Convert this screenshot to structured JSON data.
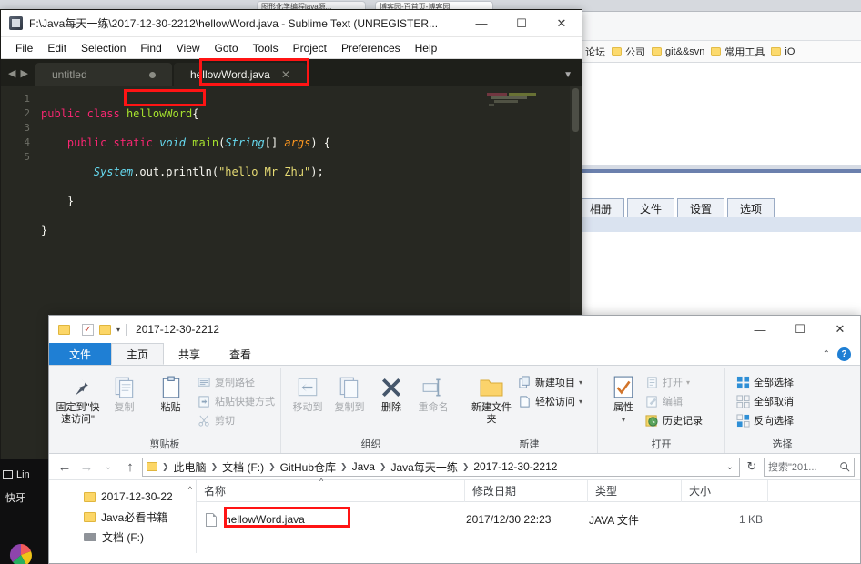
{
  "browser": {
    "tabs": [
      {
        "label": "图形化学编程java源...",
        "active": false
      },
      {
        "label": "博客园-百首页-博客园",
        "active": true
      }
    ],
    "bookmarks": [
      {
        "label": "论坛",
        "icon": "folder-icon"
      },
      {
        "label": "公司",
        "icon": "folder-icon"
      },
      {
        "label": "git&&svn",
        "icon": "folder-icon"
      },
      {
        "label": "常用工具",
        "icon": "folder-icon"
      },
      {
        "label": "iO",
        "icon": "folder-icon"
      }
    ],
    "page_tabs": [
      {
        "label": "相册"
      },
      {
        "label": "文件"
      },
      {
        "label": "设置"
      },
      {
        "label": "选项"
      }
    ]
  },
  "sublime": {
    "title": "F:\\Java每天一练\\2017-12-30-2212\\hellowWord.java - Sublime Text (UNREGISTER...",
    "window_buttons": {
      "minimize": "—",
      "maximize": "☐",
      "close": "✕"
    },
    "menu": [
      "File",
      "Edit",
      "Selection",
      "Find",
      "View",
      "Goto",
      "Tools",
      "Project",
      "Preferences",
      "Help"
    ],
    "tabs": [
      {
        "label": "untitled",
        "active": false,
        "modified": true
      },
      {
        "label": "hellowWord.java",
        "active": true,
        "modified": false
      }
    ],
    "gutter": [
      "1",
      "2",
      "3",
      "4",
      "5"
    ],
    "code_lines": [
      "public class hellowWord{",
      "    public static void main(String[] args) {",
      "        System.out.println(\"hello Mr Zhu\");",
      "    }",
      "}"
    ],
    "highlighted_token": "hellowWord{"
  },
  "explorer": {
    "title": "2017-12-30-2212",
    "window_buttons": {
      "minimize": "—",
      "maximize": "☐",
      "close": "✕"
    },
    "quick_access_caret": "▾",
    "ribbon_tabs": [
      {
        "label": "文件",
        "kind": "file"
      },
      {
        "label": "主页",
        "kind": "active"
      },
      {
        "label": "共享",
        "kind": "normal"
      },
      {
        "label": "查看",
        "kind": "normal"
      }
    ],
    "ribbon_collapse": "⌃",
    "ribbon_help": "?",
    "groups": [
      {
        "name": "剪贴板",
        "big": [
          {
            "label": "固定到\"快速访问\"",
            "icon": "pin-icon",
            "dim": false
          },
          {
            "label": "复制",
            "icon": "copy-icon",
            "dim": true
          },
          {
            "label": "粘贴",
            "icon": "paste-icon",
            "dim": false
          }
        ],
        "small": [
          {
            "label": "复制路径",
            "icon": "copy-path-icon",
            "dim": true
          },
          {
            "label": "粘贴快捷方式",
            "icon": "paste-shortcut-icon",
            "dim": true
          },
          {
            "label": "剪切",
            "icon": "scissors-icon",
            "dim": true
          }
        ]
      },
      {
        "name": "组织",
        "big": [
          {
            "label": "移动到",
            "icon": "move-to-icon",
            "dim": true
          },
          {
            "label": "复制到",
            "icon": "copy-to-icon",
            "dim": true
          },
          {
            "label": "删除",
            "icon": "delete-x-icon",
            "dim": false
          },
          {
            "label": "重命名",
            "icon": "rename-icon",
            "dim": true
          }
        ]
      },
      {
        "name": "新建",
        "big": [
          {
            "label": "新建文件夹",
            "icon": "new-folder-icon",
            "dim": false
          }
        ],
        "small": [
          {
            "label": "新建项目",
            "icon": "new-item-icon",
            "dim": false,
            "caret": "▾"
          },
          {
            "label": "轻松访问",
            "icon": "easy-access-icon",
            "dim": false,
            "caret": "▾"
          }
        ]
      },
      {
        "name": "打开",
        "big": [
          {
            "label": "属性",
            "icon": "properties-icon",
            "dim": false,
            "caret": "▾"
          }
        ],
        "small": [
          {
            "label": "打开",
            "icon": "open-icon",
            "dim": true,
            "caret": "▾"
          },
          {
            "label": "编辑",
            "icon": "edit-icon",
            "dim": true
          },
          {
            "label": "历史记录",
            "icon": "history-icon",
            "dim": false
          }
        ]
      },
      {
        "name": "选择",
        "small": [
          {
            "label": "全部选择",
            "icon": "select-all-icon",
            "dim": false
          },
          {
            "label": "全部取消",
            "icon": "select-none-icon",
            "dim": false
          },
          {
            "label": "反向选择",
            "icon": "invert-selection-icon",
            "dim": false
          }
        ]
      }
    ],
    "nav": {
      "back": "←",
      "forward": "→",
      "recent": "⌄",
      "up": "↑",
      "breadcrumbs": [
        "此电脑",
        "文档 (F:)",
        "GitHub仓库",
        "Java",
        "Java每天一练",
        "2017-12-30-2212"
      ],
      "dropdown": "⌄",
      "refresh": "↻",
      "search_placeholder": "搜索\"201...",
      "search_icon": "magnifier-icon"
    },
    "sidebar": [
      {
        "label": "2017-12-30-22",
        "icon": "folder-icon"
      },
      {
        "label": "Java必看书籍",
        "icon": "folder-icon"
      },
      {
        "label": "文档 (F:)",
        "icon": "drive-icon"
      }
    ],
    "sidebar_scroll_caret": "^",
    "columns": [
      {
        "label": "名称",
        "sorted": true,
        "sort_caret": "^"
      },
      {
        "label": "修改日期"
      },
      {
        "label": "类型"
      },
      {
        "label": "大小"
      }
    ],
    "files": [
      {
        "name": "hellowWord.java",
        "modified": "2017/12/30 22:23",
        "type": "JAVA 文件",
        "size": "1 KB",
        "highlighted": true
      }
    ]
  },
  "taskbar": {
    "items": [
      {
        "label": "Lin",
        "icon": "window-icon"
      },
      {
        "label": "快牙",
        "icon": "app-icon"
      }
    ]
  },
  "colors": {
    "highlight_red": "#ff1414",
    "accent_blue": "#1f7fd4",
    "editor_bg": "#272822"
  }
}
